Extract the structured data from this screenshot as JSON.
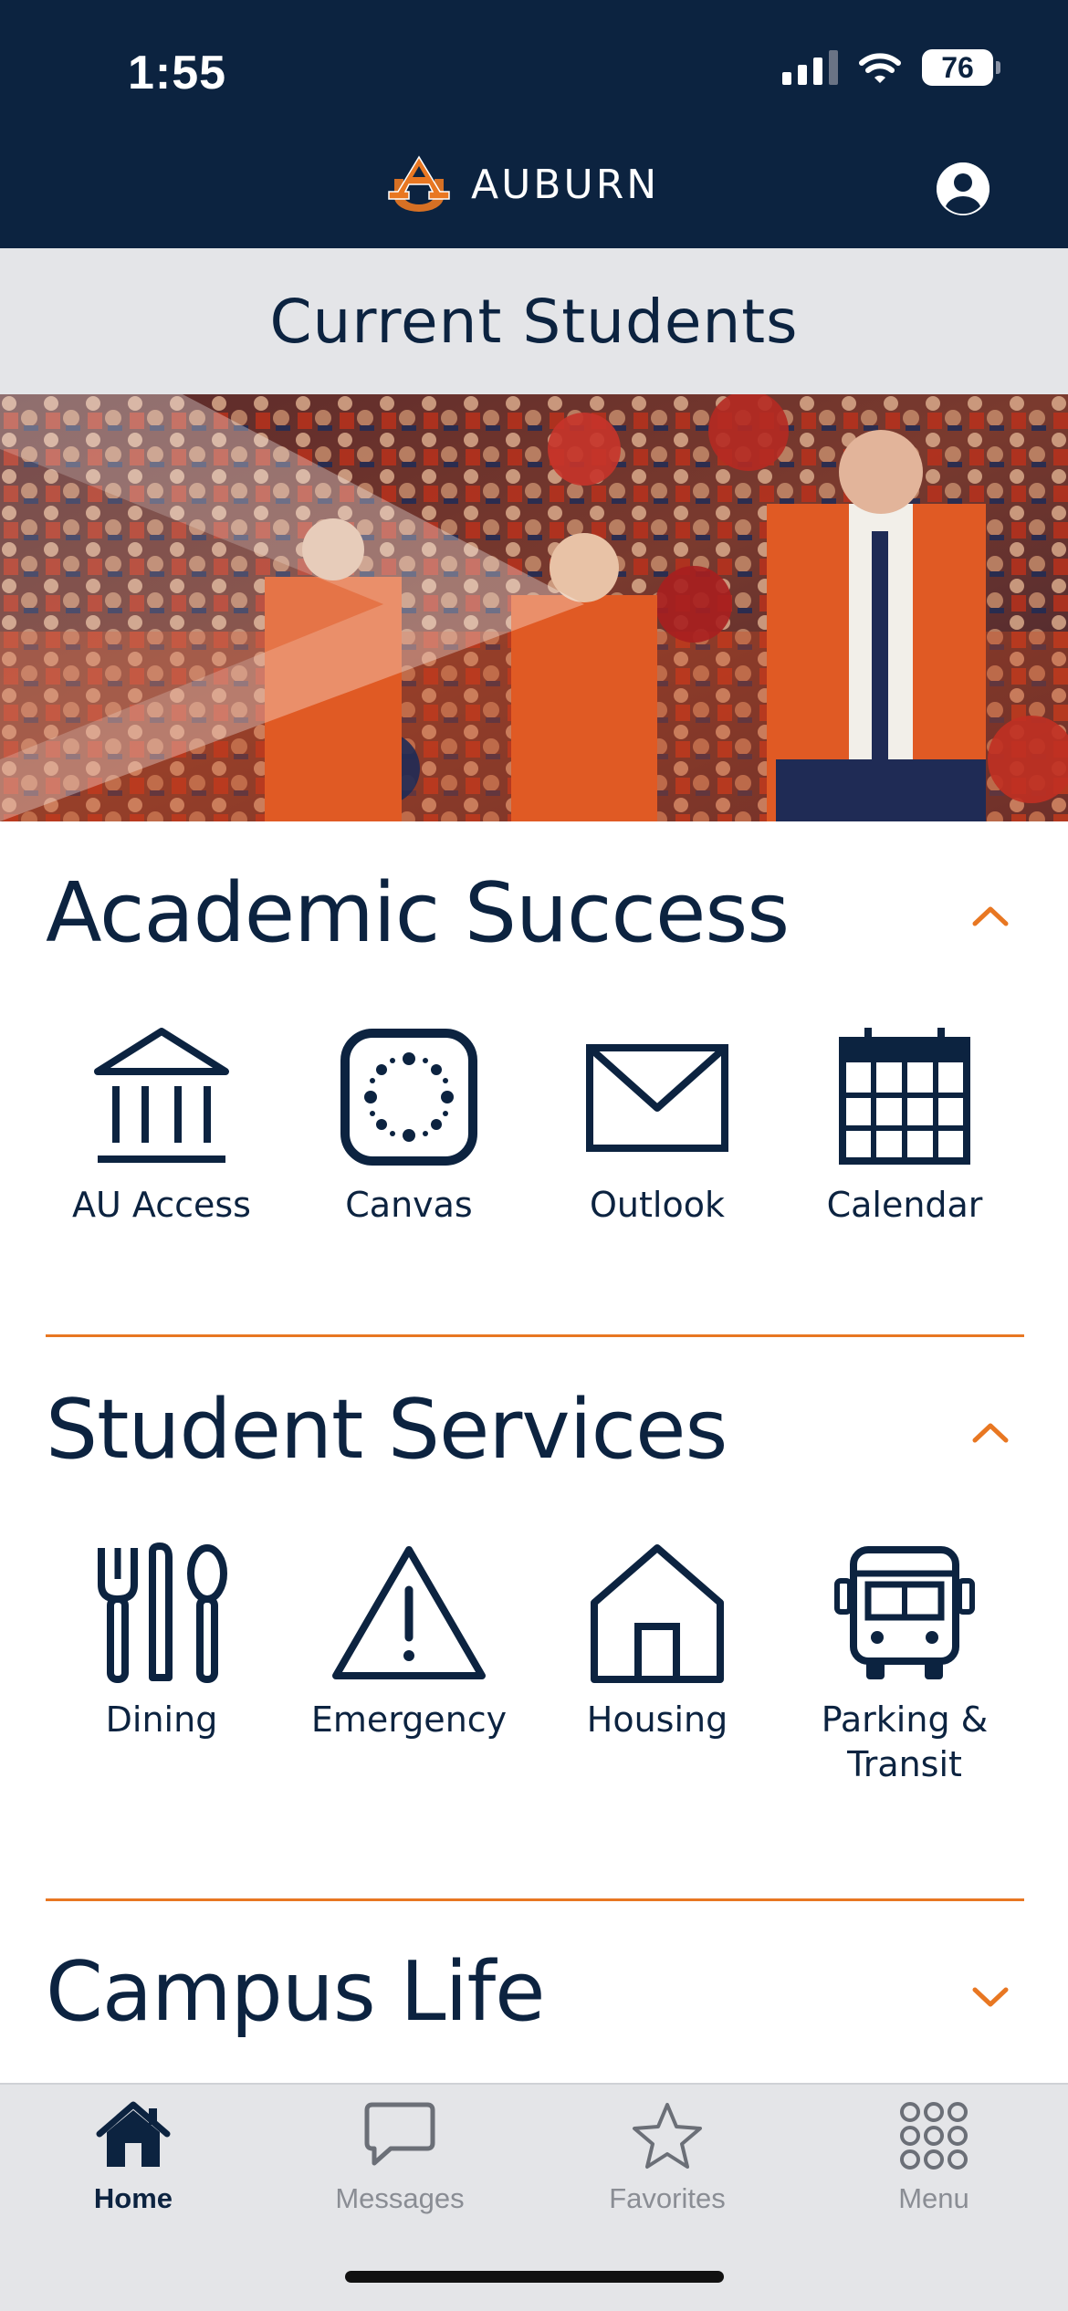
{
  "status": {
    "time": "1:55",
    "battery": "76"
  },
  "header": {
    "wordmark": "AUBURN"
  },
  "page": {
    "title": "Current Students"
  },
  "sections": [
    {
      "title": "Academic Success",
      "expanded": true,
      "items": [
        {
          "label": "AU Access",
          "icon": "building-columns-icon"
        },
        {
          "label": "Canvas",
          "icon": "canvas-icon"
        },
        {
          "label": "Outlook",
          "icon": "envelope-icon"
        },
        {
          "label": "Calendar",
          "icon": "calendar-icon"
        }
      ]
    },
    {
      "title": "Student Services",
      "expanded": true,
      "items": [
        {
          "label": "Dining",
          "icon": "utensils-icon"
        },
        {
          "label": "Emergency",
          "icon": "warning-triangle-icon"
        },
        {
          "label": "Housing",
          "icon": "house-icon"
        },
        {
          "label": "Parking &",
          "label2": "Transit",
          "icon": "bus-icon"
        }
      ]
    },
    {
      "title": "Campus Life",
      "expanded": false,
      "items": []
    }
  ],
  "tabbar": {
    "tabs": [
      {
        "label": "Home",
        "icon": "home-icon",
        "active": true
      },
      {
        "label": "Messages",
        "icon": "chat-bubble-icon",
        "active": false
      },
      {
        "label": "Favorites",
        "icon": "star-icon",
        "active": false
      },
      {
        "label": "Menu",
        "icon": "grid-dots-icon",
        "active": false
      }
    ]
  },
  "colors": {
    "navy": "#0c2340",
    "orange": "#e87722",
    "gray": "#e4e5e8"
  }
}
